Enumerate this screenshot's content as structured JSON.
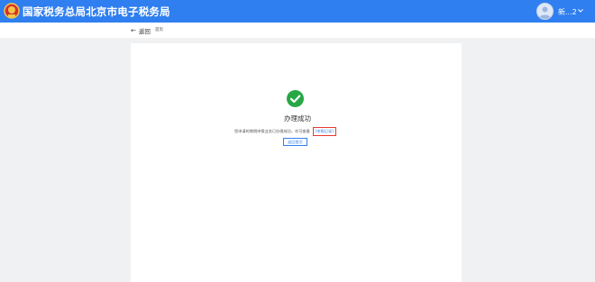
{
  "header": {
    "site_title": "国家税务总局北京市电子税务局",
    "user_name": "新...2",
    "background_color": "#2f7ff0",
    "emblem_icon": "tax-emblem-icon",
    "avatar_icon": "user-avatar-icon",
    "chevron_icon": "chevron-down-icon"
  },
  "subbar": {
    "back_label": "返回",
    "breadcrumb": "首页"
  },
  "result": {
    "status": "success",
    "icon": "check-circle-icon",
    "icon_color": "#27a745",
    "title": "办理成功",
    "message": "您申请的增税申报业务已办理成功，亦可查看",
    "record_link_label": "[申报记录]",
    "return_button_label": "返回首页"
  }
}
